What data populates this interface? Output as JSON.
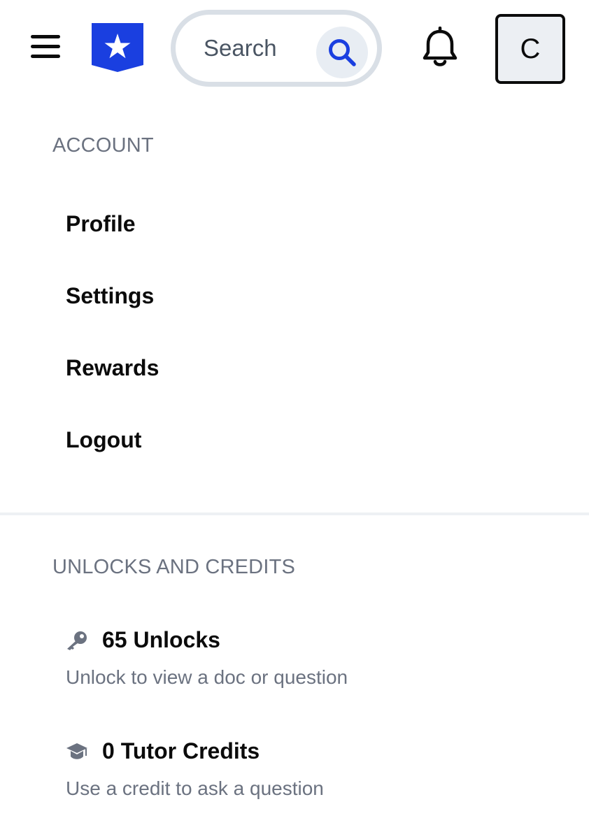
{
  "header": {
    "search_placeholder": "Search",
    "avatar_initial": "C"
  },
  "colors": {
    "brand_blue": "#1a3fe0",
    "search_border": "#d9dfe6",
    "muted_text": "#6b7280"
  },
  "icons": [
    "menu-icon",
    "star-bookmark-logo",
    "search-icon",
    "bell-icon",
    "key-icon",
    "graduation-cap-icon"
  ],
  "account": {
    "title": "ACCOUNT",
    "items": [
      {
        "label": "Profile"
      },
      {
        "label": "Settings"
      },
      {
        "label": "Rewards"
      },
      {
        "label": "Logout"
      }
    ]
  },
  "unlocks": {
    "title": "UNLOCKS AND CREDITS",
    "items": [
      {
        "title": "65 Unlocks",
        "description": "Unlock to view a doc or question"
      },
      {
        "title": "0 Tutor Credits",
        "description": "Use a credit to ask a question"
      }
    ]
  }
}
